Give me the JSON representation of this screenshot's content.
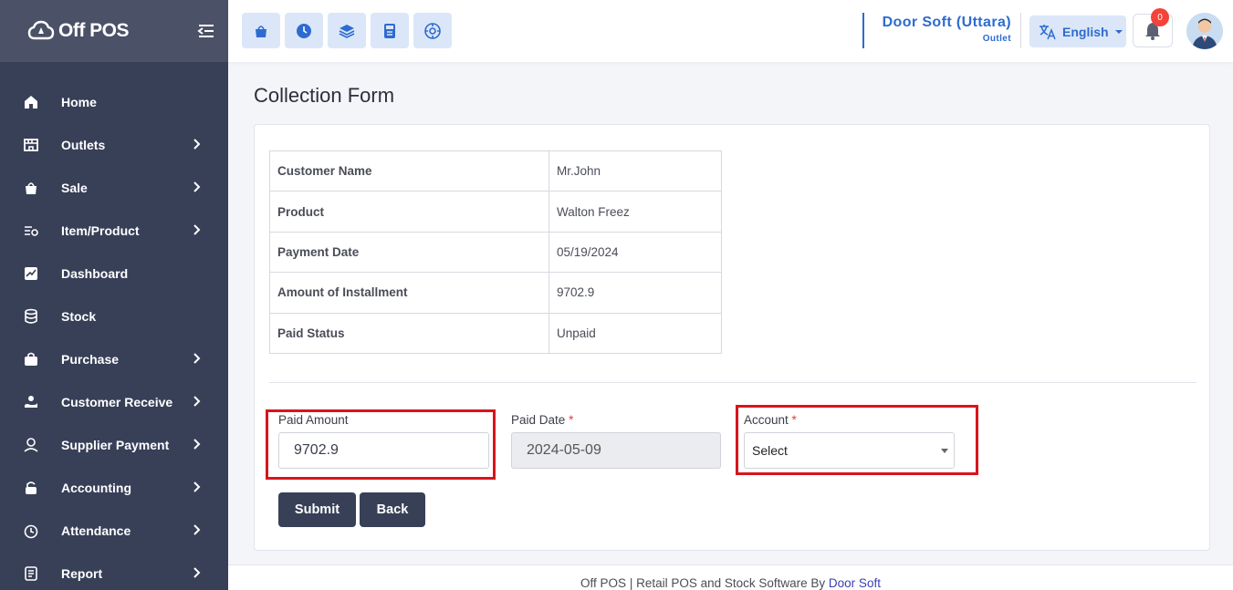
{
  "brand": {
    "name": "Off POS"
  },
  "sidebar": {
    "items": [
      {
        "label": "Home",
        "icon": "home-icon",
        "has_submenu": false
      },
      {
        "label": "Outlets",
        "icon": "store-icon",
        "has_submenu": true
      },
      {
        "label": "Sale",
        "icon": "basket-icon",
        "has_submenu": true
      },
      {
        "label": "Item/Product",
        "icon": "list-icon",
        "has_submenu": true
      },
      {
        "label": "Dashboard",
        "icon": "chart-icon",
        "has_submenu": false
      },
      {
        "label": "Stock",
        "icon": "database-icon",
        "has_submenu": false
      },
      {
        "label": "Purchase",
        "icon": "bag-icon",
        "has_submenu": true
      },
      {
        "label": "Customer Receive",
        "icon": "hand-money-icon",
        "has_submenu": true
      },
      {
        "label": "Supplier Payment",
        "icon": "supplier-icon",
        "has_submenu": true
      },
      {
        "label": "Accounting",
        "icon": "lock-icon",
        "has_submenu": true
      },
      {
        "label": "Attendance",
        "icon": "clock-icon",
        "has_submenu": true
      },
      {
        "label": "Report",
        "icon": "report-icon",
        "has_submenu": true
      }
    ]
  },
  "header": {
    "quick_icons": [
      "basket-icon",
      "clock-icon",
      "layers-icon",
      "calculator-icon",
      "dashboard-icon"
    ],
    "outlet_name": "Door Soft (Uttara)",
    "outlet_sub": "Outlet",
    "language": "English",
    "notification_count": "0"
  },
  "main": {
    "title": "Collection Form",
    "info_rows": [
      {
        "label": "Customer Name",
        "value": "Mr.John"
      },
      {
        "label": "Product",
        "value": "Walton Freez"
      },
      {
        "label": "Payment Date",
        "value": "05/19/2024"
      },
      {
        "label": "Amount of Installment",
        "value": "9702.9"
      },
      {
        "label": "Paid Status",
        "value": "Unpaid"
      }
    ],
    "form": {
      "paid_amount_label": "Paid Amount",
      "paid_amount_value": "9702.9",
      "paid_date_label": "Paid Date",
      "paid_date_value": "2024-05-09",
      "account_label": "Account",
      "account_value": "Select",
      "required_mark": "*",
      "submit_label": "Submit",
      "back_label": "Back"
    }
  },
  "footer": {
    "text": "Off POS | Retail POS and Stock Software By ",
    "link": "Door Soft"
  },
  "colors": {
    "sidebar_bg": "#384058",
    "accent_blue": "#2e6bd0",
    "highlight_red": "#d9141c",
    "button_bg": "#384058"
  }
}
